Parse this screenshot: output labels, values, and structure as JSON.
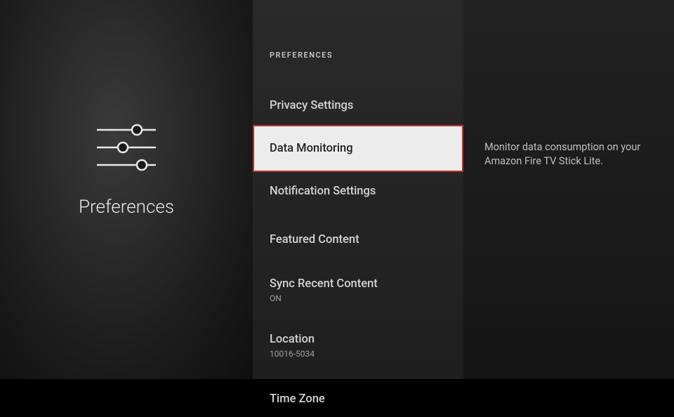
{
  "left": {
    "title": "Preferences"
  },
  "middle": {
    "header": "PREFERENCES",
    "items": [
      {
        "label": "Privacy Settings",
        "sublabel": null,
        "selected": false
      },
      {
        "label": "Data Monitoring",
        "sublabel": null,
        "selected": true
      },
      {
        "label": "Notification Settings",
        "sublabel": null,
        "selected": false
      },
      {
        "label": "Featured Content",
        "sublabel": null,
        "selected": false
      },
      {
        "label": "Sync Recent Content",
        "sublabel": "ON",
        "selected": false
      },
      {
        "label": "Location",
        "sublabel": "10016-5034",
        "selected": false
      },
      {
        "label": "Time Zone",
        "sublabel": null,
        "selected": false
      }
    ]
  },
  "right": {
    "description": "Monitor data consumption on your Amazon Fire TV Stick Lite."
  }
}
